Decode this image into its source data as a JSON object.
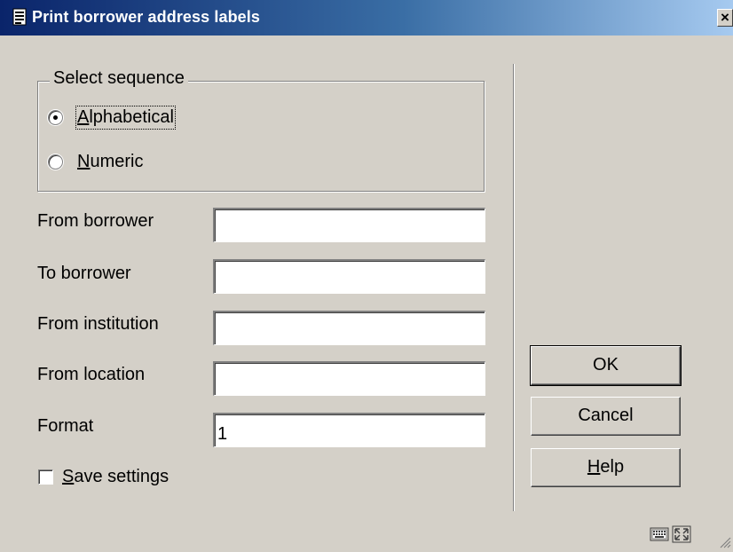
{
  "window": {
    "title": "Print borrower address labels",
    "close_label": "×"
  },
  "sequence": {
    "legend": "Select sequence",
    "options": [
      {
        "label_mnemonic": "A",
        "label_rest": "lphabetical",
        "selected": true
      },
      {
        "label_mnemonic": "N",
        "label_rest": "umeric",
        "selected": false
      }
    ]
  },
  "fields": [
    {
      "label": "From borrower",
      "value": ""
    },
    {
      "label": "To borrower",
      "value": ""
    },
    {
      "label": "From institution",
      "value": ""
    },
    {
      "label": "From location",
      "value": ""
    },
    {
      "label": "Format",
      "value": "1"
    }
  ],
  "save_settings": {
    "label_mnemonic": "S",
    "label_rest": "ave settings",
    "checked": false
  },
  "buttons": {
    "ok": "OK",
    "cancel": "Cancel",
    "help_mnemonic": "H",
    "help_rest": "elp"
  },
  "status_icons": [
    "keyboard-icon",
    "resize-icon"
  ]
}
